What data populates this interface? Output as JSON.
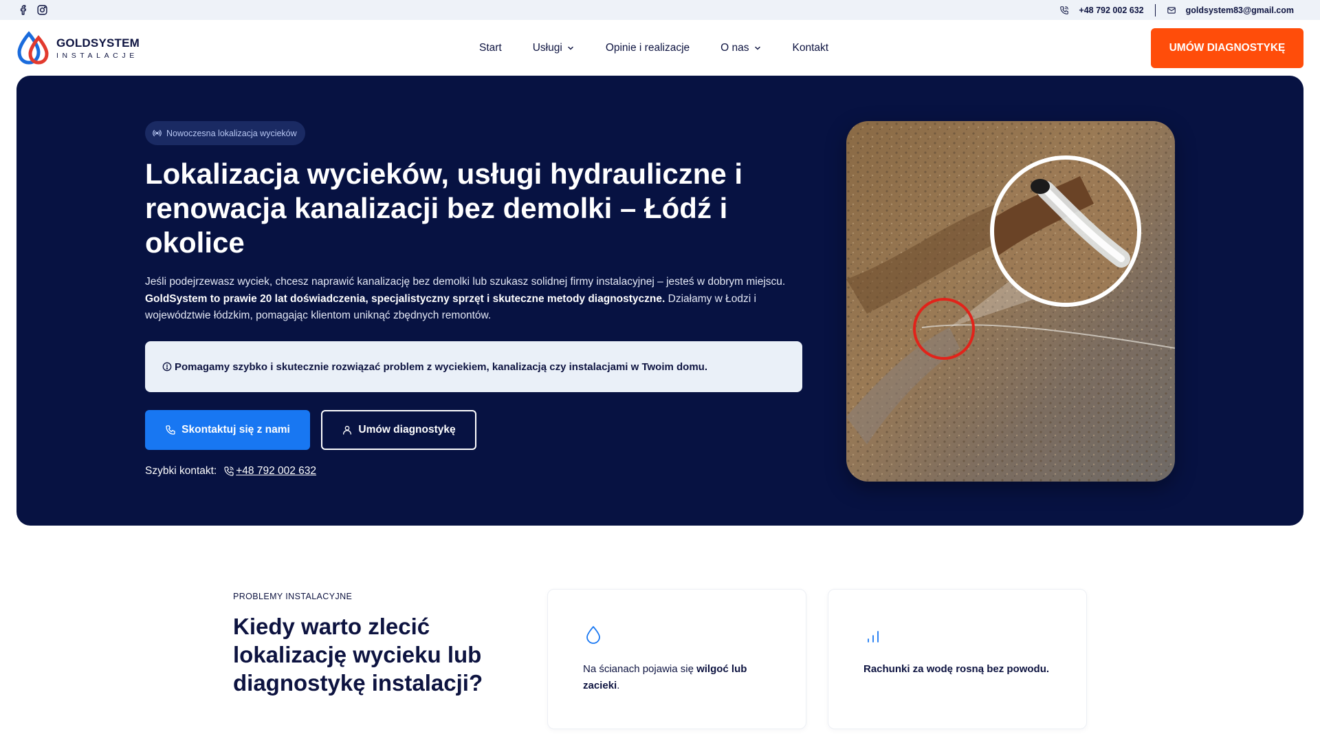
{
  "colors": {
    "navy": "#071242",
    "text": "#0d1340",
    "accent_orange": "#ff4d0a",
    "accent_blue": "#1877f2",
    "logo_blue": "#1a6bdc",
    "logo_red": "#e23a2e"
  },
  "topbar": {
    "social_icons": [
      "facebook-icon",
      "instagram-icon"
    ],
    "phone": "+48  792 002 632",
    "email": "goldsystem83@gmail.com"
  },
  "header": {
    "logo_title": "GOLDSYSTEM",
    "logo_subtitle": "INSTALACJE",
    "nav": [
      {
        "label": "Start",
        "dropdown": false
      },
      {
        "label": "Usługi",
        "dropdown": true
      },
      {
        "label": "Opinie i realizacje",
        "dropdown": false
      },
      {
        "label": "O nas",
        "dropdown": true
      },
      {
        "label": "Kontakt",
        "dropdown": false
      }
    ],
    "cta_label": "UMÓW DIAGNOSTYKĘ"
  },
  "hero": {
    "badge": "Nowoczesna lokalizacja wycieków",
    "title": "Lokalizacja wycieków, usługi hydrauliczne i renowacja kanalizacji bez demolki – Łódź i okolice",
    "lead_part1": "Jeśli podejrzewasz wyciek, chcesz naprawić kanalizację bez demolki lub szukasz solidnej firmy instalacyjnej – jesteś w dobrym miejscu. ",
    "lead_bold": "GoldSystem to prawie 20 lat doświadczenia, specjalistyczny sprzęt i skuteczne metody diagnostyczne.",
    "lead_part2": " Działamy w Łodzi i województwie łódzkim, pomagając klientom uniknąć zbędnych remontów.",
    "notice": "Pomagamy szybko i skutecznie rozwiązać problem z wyciekiem, kanalizacją czy instalacjami w Twoim domu.",
    "primary_button": "Skontaktuj się z nami",
    "secondary_button": "Umów diagnostykę",
    "quick_contact_label": "Szybki kontakt:",
    "quick_contact_phone": "+48 792 002 632"
  },
  "problems": {
    "eyebrow": "PROBLEMY INSTALACYJNE",
    "title": "Kiedy warto zlecić lokalizację wycieku lub diagnostykę instalacji?",
    "cards": [
      {
        "icon": "droplet-icon",
        "text_before": "Na ścianach pojawia się ",
        "text_bold": "wilgoć lub zacieki",
        "text_after": "."
      },
      {
        "icon": "bar-chart-icon",
        "text_before": "",
        "text_bold": "Rachunki za wodę rosną bez powodu.",
        "text_after": ""
      }
    ]
  }
}
